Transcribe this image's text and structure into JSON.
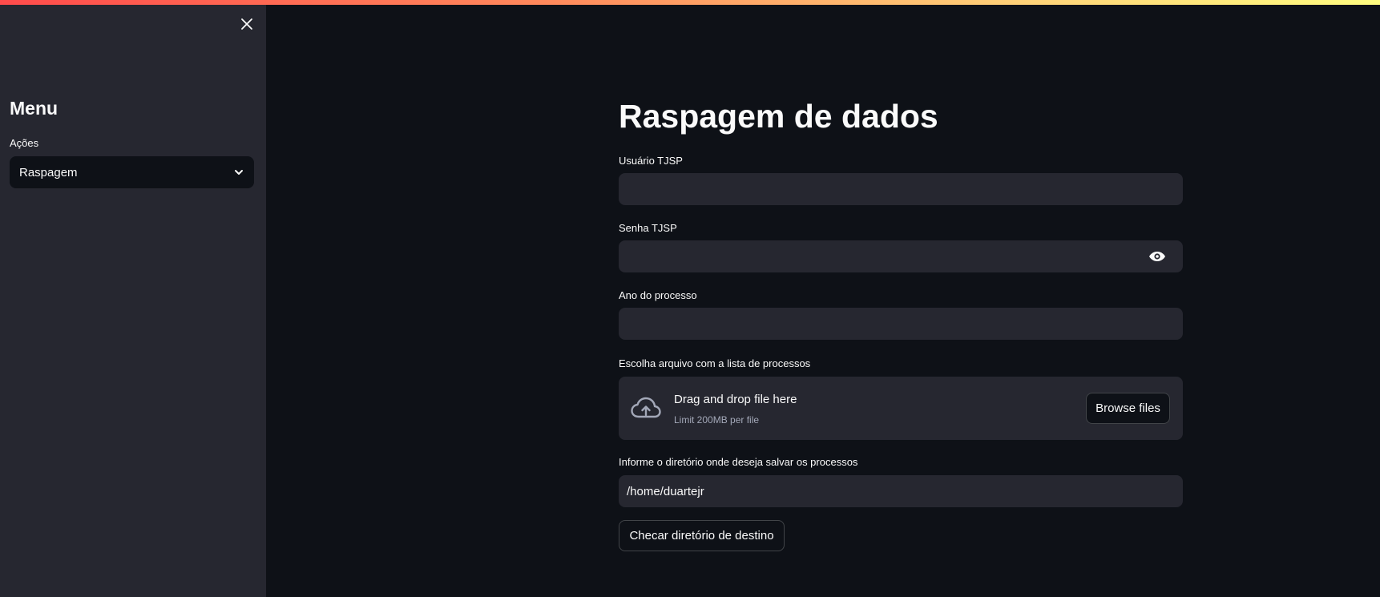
{
  "colors": {
    "background": "#0e1117",
    "sidebar": "#262730",
    "input_bg": "#262730",
    "text": "#fafafa",
    "muted_text": "#a3a8b8"
  },
  "sidebar": {
    "close_icon": "close-icon",
    "title": "Menu",
    "select": {
      "label": "Ações",
      "value": "Raspagem",
      "icon": "chevron-down-icon"
    }
  },
  "main": {
    "title": "Raspagem de dados",
    "user_field": {
      "label": "Usuário TJSP",
      "value": ""
    },
    "password_field": {
      "label": "Senha TJSP",
      "value": "",
      "icon": "eye-icon"
    },
    "year_field": {
      "label": "Ano do processo",
      "value": ""
    },
    "uploader": {
      "label": "Escolha arquivo com a lista de processos",
      "icon": "cloud-upload-icon",
      "main_text": "Drag and drop file here",
      "sub_text": "Limit 200MB per file",
      "button_label": "Browse files"
    },
    "directory_field": {
      "label": "Informe o diretório onde deseja salvar os processos",
      "value": "/home/duartejr"
    },
    "check_button_label": "Checar diretório de destino"
  }
}
